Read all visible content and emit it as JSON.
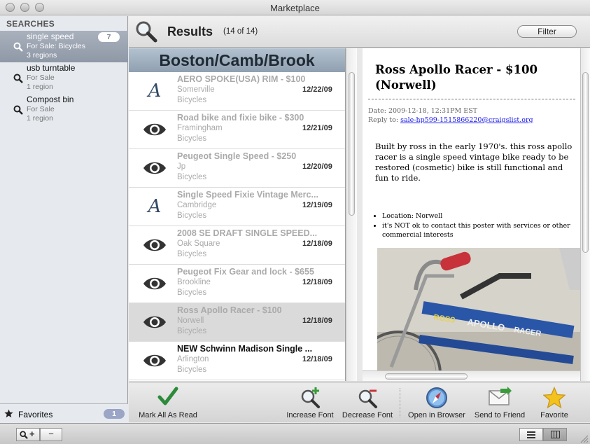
{
  "window": {
    "title": "Marketplace"
  },
  "sidebar": {
    "heading": "SEARCHES",
    "searches": [
      {
        "name": "single speed",
        "category": "For Sale: Bicycles",
        "regions": "3 regions",
        "badge": "7",
        "selected": true
      },
      {
        "name": "usb turntable",
        "category": "For Sale",
        "regions": "1 region"
      },
      {
        "name": "Compost bin",
        "category": "For Sale",
        "regions": "1 region"
      }
    ],
    "favorites": {
      "label": "Favorites",
      "badge": "1"
    }
  },
  "status_bar": {
    "zoom_in_label": "+",
    "zoom_out_label": "−"
  },
  "results": {
    "title": "Results",
    "count": "(14 of 14)",
    "filter_label": "Filter",
    "region": "Boston/Camb/Brook",
    "rows": [
      {
        "title": "AERO SPOKE(USA) RIM - $100",
        "location": "Somerville",
        "category": "Bicycles",
        "date": "12/22/09",
        "icon": "font-icon"
      },
      {
        "title": "Road bike and fixie bike - $300",
        "location": "Framingham",
        "category": "Bicycles",
        "date": "12/21/09",
        "icon": "eye-icon"
      },
      {
        "title": "Peugeot Single Speed - $250",
        "location": "Jp",
        "category": "Bicycles",
        "date": "12/20/09",
        "icon": "eye-icon"
      },
      {
        "title": "Single Speed Fixie Vintage Merc...",
        "location": "Cambridge",
        "category": "Bicycles",
        "date": "12/19/09",
        "icon": "font-icon"
      },
      {
        "title": "2008 SE DRAFT SINGLE SPEED...",
        "location": "Oak Square",
        "category": "Bicycles",
        "date": "12/18/09",
        "icon": "eye-icon"
      },
      {
        "title": "Peugeot Fix Gear and lock - $655",
        "location": "Brookline",
        "category": "Bicycles",
        "date": "12/18/09",
        "icon": "eye-icon"
      },
      {
        "title": "Ross Apollo Racer - $100",
        "location": "Norwell",
        "category": "Bicycles",
        "date": "12/18/09",
        "icon": "eye-icon",
        "selected": true
      },
      {
        "title": "NEW Schwinn Madison Single ...",
        "location": "Arlington",
        "category": "Bicycles",
        "date": "12/18/09",
        "icon": "eye-icon",
        "unread": true
      }
    ]
  },
  "detail": {
    "title": "Ross Apollo Racer - $100 (Norwell)",
    "date": "Date: 2009-12-18, 12:31PM EST",
    "reply_label": "Reply to:",
    "reply_email": "sale-hp599-1515866220@craigslist.org",
    "body": "Built by ross in the early 1970's. this ross apollo racer is a single speed vintage bike ready to be restored (cosmetic) bike is still functional and fun to ride.",
    "bullets": [
      "Location: Norwell",
      "it's NOT ok to contact this poster with services or other commercial interests"
    ],
    "photo_text": {
      "brand": "ROSS",
      "model": "APOLLO",
      "sub": "RACER"
    }
  },
  "toolbar": {
    "mark_all_read": "Mark All As Read",
    "increase_font": "Increase Font",
    "decrease_font": "Decrease Font",
    "open_browser": "Open in Browser",
    "send_friend": "Send to Friend",
    "favorite": "Favorite"
  },
  "colors": {
    "accent": "#2c8a3a",
    "selection": "#dadada",
    "region_header": "#a3b2c1"
  }
}
